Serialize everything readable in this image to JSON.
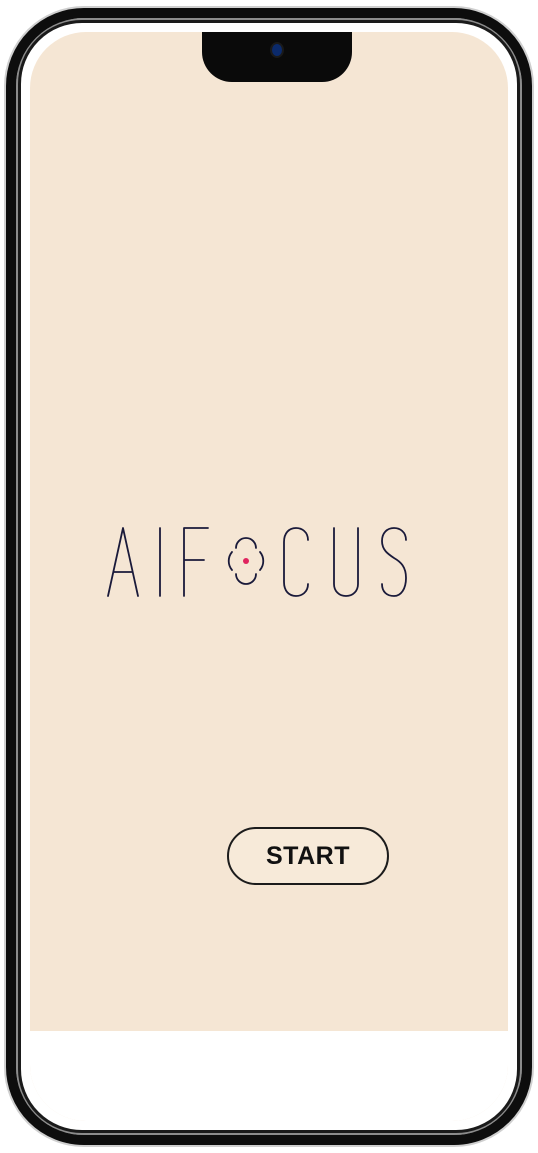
{
  "app": {
    "logo_text": "AIFOCUS",
    "logo_letters": [
      "A",
      "I",
      "F",
      "C",
      "U",
      "S"
    ],
    "logo_focus_symbol": "focus-ring-icon"
  },
  "actions": {
    "start_label": "START"
  },
  "colors": {
    "screen_background": "#f5e6d4",
    "logo_stroke": "#1a1a3a",
    "logo_accent": "#e0245e",
    "button_border": "#1c1c1c",
    "frame": "#0d0d0d"
  }
}
